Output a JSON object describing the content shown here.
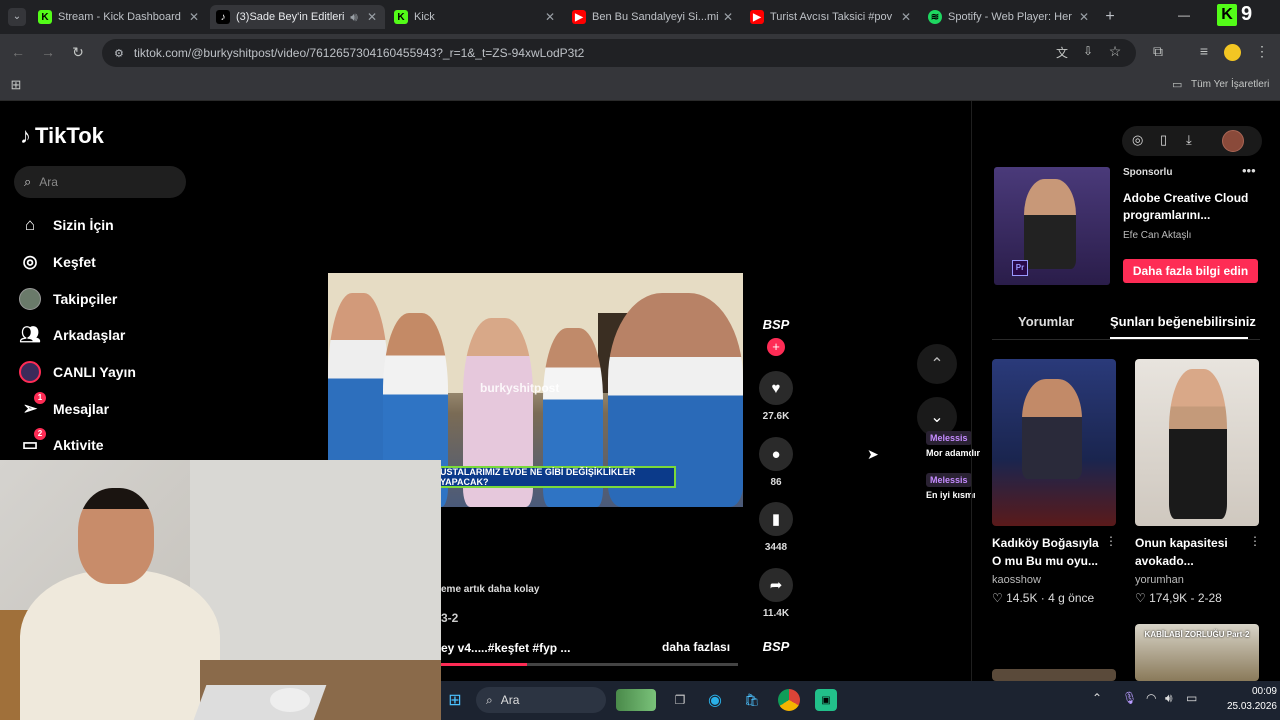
{
  "tabs": [
    {
      "title": "Stream - Kick Dashboard",
      "favicon": "kick-icon",
      "color": "#53fc18"
    },
    {
      "title": "(3)Sade Bey'in Editleri",
      "favicon": "tiktok-icon",
      "color": "#ffffff"
    },
    {
      "title": "Kick",
      "favicon": "kick-icon",
      "color": "#53fc18"
    },
    {
      "title": "Ben Bu Sandalyeyi Si...mi",
      "favicon": "youtube-icon",
      "color": "#ff0000"
    },
    {
      "title": "Turist Avcısı Taksici #pov",
      "favicon": "youtube-icon",
      "color": "#ff0000"
    },
    {
      "title": "Spotify - Web Player: Her",
      "favicon": "spotify-icon",
      "color": "#1ed760"
    }
  ],
  "url": "tiktok.com/@burkyshitpost/video/7612657304160455943?_r=1&_t=ZS-94xwLodP3t2",
  "bookmarks": {
    "all_bookmarks": "Tüm Yer İşaretleri"
  },
  "kick_badge": "9",
  "tiktok": {
    "logo": "TikTok",
    "search_placeholder": "Ara",
    "nav": [
      {
        "label": "Sizin İçin",
        "icon": "home-icon"
      },
      {
        "label": "Keşfet",
        "icon": "compass-icon"
      },
      {
        "label": "Takipçiler",
        "icon": "avatar-icon"
      },
      {
        "label": "Arkadaşlar",
        "icon": "friends-icon"
      },
      {
        "label": "CANLI Yayın",
        "icon": "live-icon"
      },
      {
        "label": "Mesajlar",
        "icon": "message-icon",
        "badge": "1"
      },
      {
        "label": "Aktivite",
        "icon": "activity-icon",
        "badge": "2"
      }
    ],
    "video": {
      "watermark": "burkyshitpost",
      "caption_overlay": "USTALARIMIZ EVDE NE GİBİ DEĞİŞİKLİKLER YAPACAK?",
      "desc_line1": "eme artık daha kolay",
      "desc_line2": "3-2",
      "desc_line3": "ey v4.....#keşfet #fyp ...",
      "more": "daha fazlası"
    },
    "actions": {
      "likes": "27.6K",
      "comments": "86",
      "saves": "3448",
      "shares": "11.4K"
    },
    "channel_badge": "BSP",
    "chat": [
      {
        "name": "Melessis",
        "msg": "Mor adamdır"
      },
      {
        "name": "Melessis",
        "msg": "En iyi kısmı"
      }
    ],
    "sponsored": {
      "label": "Sponsorlu",
      "title": "Adobe Creative Cloud programlarını...",
      "author": "Efe Can Aktaşlı",
      "cta": "Daha fazla bilgi edin"
    },
    "right_tabs": [
      "Yorumlar",
      "Şunları beğenebilirsiniz"
    ],
    "suggestions": [
      {
        "title": "Kadıköy Boğasıyla O mu Bu mu oyu...",
        "author": "kaosshow",
        "likes": "14.5K",
        "date": "4 g önce"
      },
      {
        "title": "Onun kapasitesi avokado...",
        "author": "yorumhan",
        "likes": "174,9K",
        "date": "2-28"
      }
    ],
    "third_tile_text": "KABİLABİ ZORLUĞU Part-2"
  },
  "taskbar": {
    "search": "Ara",
    "time": "00:09",
    "date": "25.03.2026"
  }
}
